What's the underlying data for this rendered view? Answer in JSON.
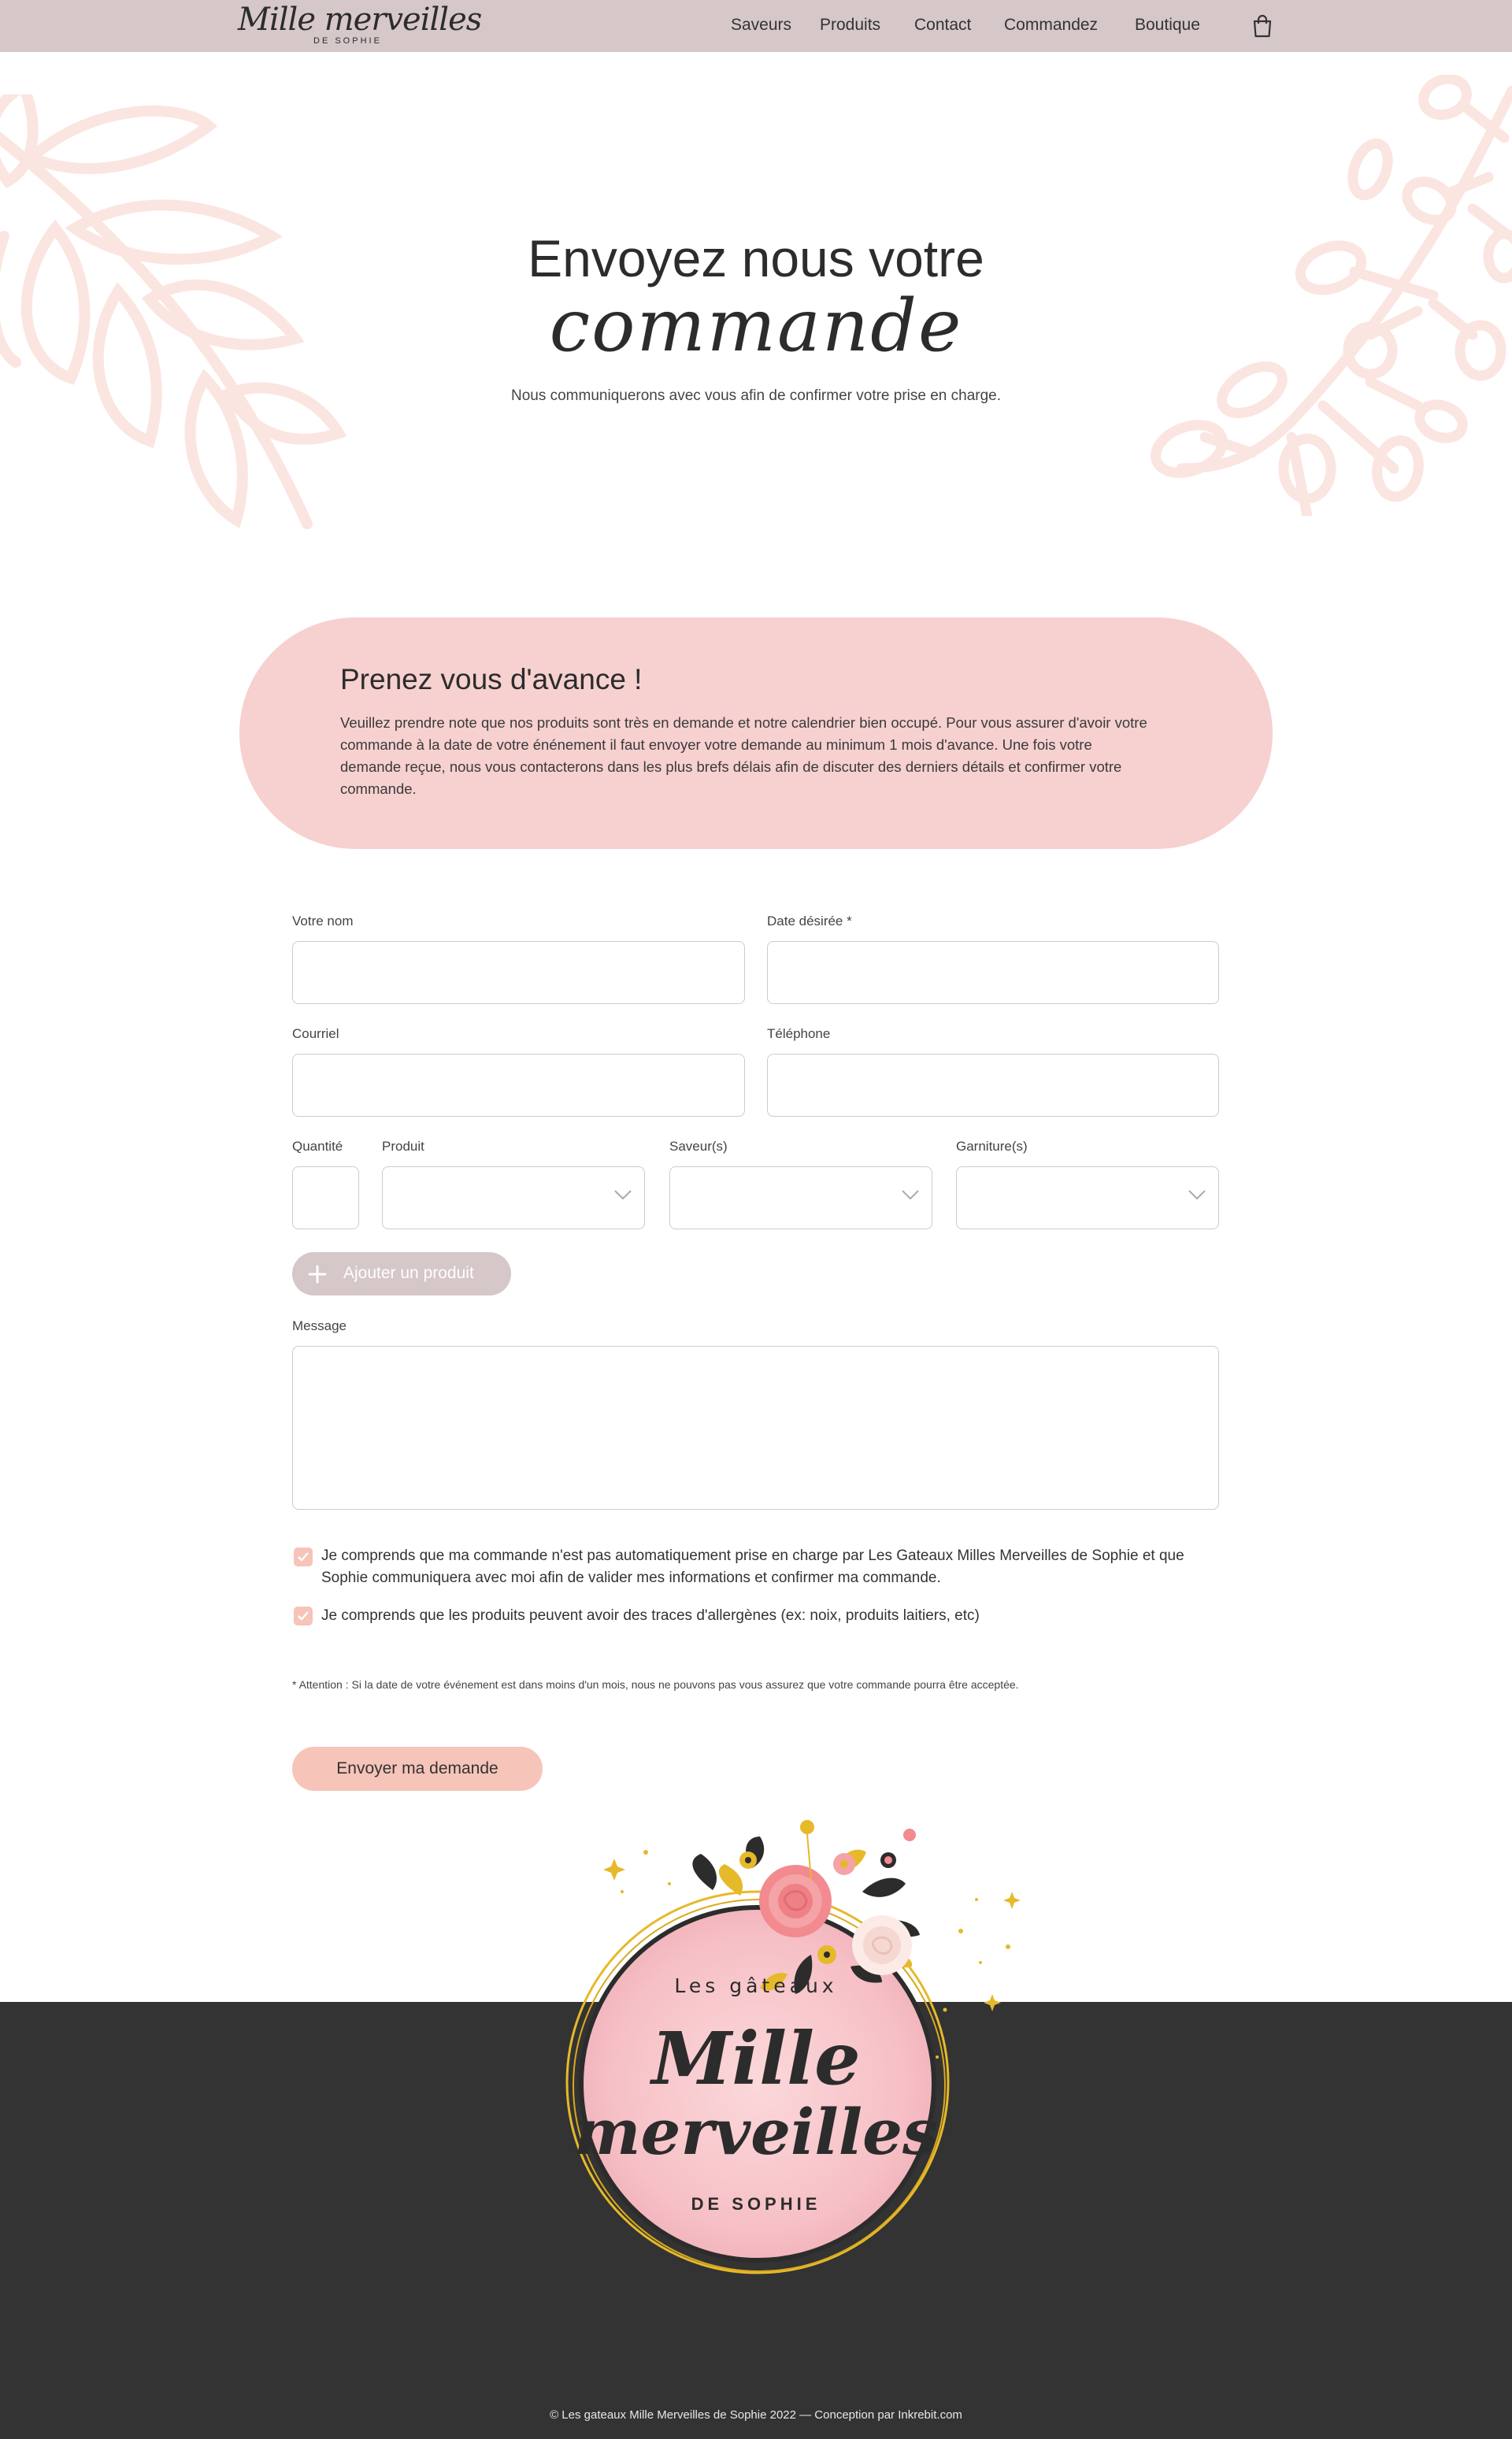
{
  "nav": {
    "logo_main": "Mille merveilles",
    "logo_sub": "DE SOPHIE",
    "links": [
      "Saveurs",
      "Produits",
      "Contact",
      "Commandez",
      "Boutique"
    ],
    "cart_icon": "shopping-bag-icon"
  },
  "hero": {
    "title": "Envoyez nous votre",
    "script": "commande",
    "subtitle": "Nous communiquerons avec vous afin de confirmer votre prise en charge."
  },
  "notice": {
    "title": "Prenez vous d'avance !",
    "body": "Veuillez prendre note que nos produits sont très en demande et notre calendrier bien occupé. Pour vous assurer d'avoir votre commande à la date de votre énénement il faut envoyer votre demande au minimum 1 mois d'avance. Une fois votre demande reçue, nous vous contacterons dans les plus brefs délais afin de discuter des derniers détails et confirmer votre commande."
  },
  "form": {
    "name_label": "Votre nom",
    "date_label": "Date désirée *",
    "email_label": "Courriel",
    "phone_label": "Téléphone",
    "quantity_label": "Quantité",
    "product_label": "Produit",
    "flavor_label": "Saveur(s)",
    "topping_label": "Garniture(s)",
    "add_product_label": "Ajouter un produit",
    "message_label": "Message",
    "checkbox1": "Je comprends que ma commande n'est pas automatiquement prise en charge par Les Gateaux Milles Merveilles de Sophie et que Sophie communiquera avec moi afin de valider mes informations et confirmer ma commande.",
    "checkbox2": "Je comprends que les produits peuvent avoir des traces d'allergènes (ex: noix, produits laitiers, etc)",
    "checkbox1_checked": true,
    "checkbox2_checked": true,
    "attention": "* Attention : Si la date de votre événement est dans moins d'un mois, nous ne pouvons pas vous assurez que votre commande pourra être acceptée.",
    "submit_label": "Envoyer ma demande"
  },
  "footer": {
    "badge_top": "Les gâteaux",
    "badge_mille": "Mille",
    "badge_merveilles": "merveilles",
    "badge_de": "DE SOPHIE",
    "copyright": "© Les gateaux Mille Merveilles de Sophie 2022 — Conception par Inkrebit.com"
  },
  "colors": {
    "nav_bg": "#d6c7c8",
    "notice_bg": "#f7d0d0",
    "accent": "#f6c4b8",
    "footer_bg": "#333333",
    "leaf": "#fbe5e0"
  }
}
